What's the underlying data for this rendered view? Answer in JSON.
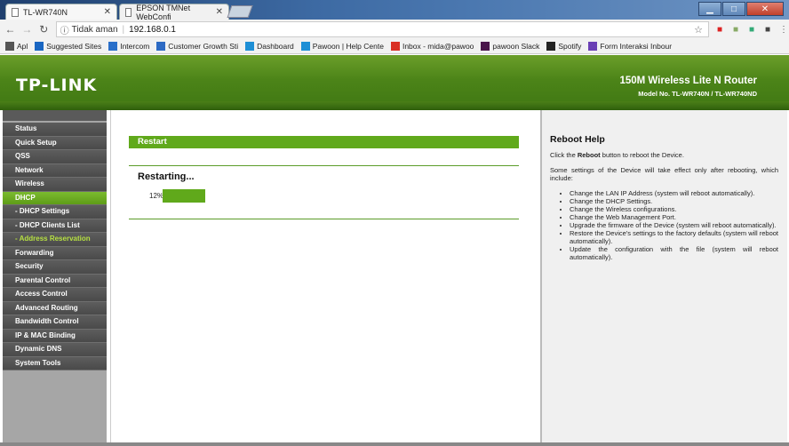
{
  "browser": {
    "tabs": [
      {
        "label": "TL-WR740N"
      },
      {
        "label": "EPSON TMNet WebConfi"
      }
    ],
    "address": {
      "security": "Tidak aman",
      "url": "192.168.0.1"
    },
    "bookmarks": [
      {
        "label": "Apl",
        "icon": "apps-grid-icon",
        "color": "#555555"
      },
      {
        "label": "Suggested Sites",
        "icon": "suggested-sites-icon",
        "color": "#1a66c2"
      },
      {
        "label": "Intercom",
        "icon": "intercom-icon",
        "color": "#2a6fc9"
      },
      {
        "label": "Customer Growth Sti",
        "icon": "sheet-icon",
        "color": "#2d6ac4"
      },
      {
        "label": "Dashboard",
        "icon": "p-icon",
        "color": "#1e8fd6"
      },
      {
        "label": "Pawoon | Help Cente",
        "icon": "p-icon",
        "color": "#1e8fd6"
      },
      {
        "label": "Inbox - mida@pawoo",
        "icon": "gmail-icon",
        "color": "#d93025"
      },
      {
        "label": "pawoon Slack",
        "icon": "slack-icon",
        "color": "#4a154b"
      },
      {
        "label": "Spotify",
        "icon": "spotify-icon",
        "color": "#222222"
      },
      {
        "label": "Form Interaksi Inbour",
        "icon": "form-icon",
        "color": "#6a3fb5"
      }
    ]
  },
  "router": {
    "brand": "TP-LINK",
    "product_name": "150M Wireless Lite N Router",
    "model": "Model No. TL-WR740N / TL-WR740ND"
  },
  "menu": [
    {
      "label": "Status",
      "key": "status"
    },
    {
      "label": "Quick Setup",
      "key": "quick-setup"
    },
    {
      "label": "QSS",
      "key": "qss"
    },
    {
      "label": "Network",
      "key": "network"
    },
    {
      "label": "Wireless",
      "key": "wireless"
    },
    {
      "label": "DHCP",
      "key": "dhcp"
    },
    {
      "label": "- DHCP Settings",
      "key": "dhcp-settings"
    },
    {
      "label": "- DHCP Clients List",
      "key": "dhcp-clients-list"
    },
    {
      "label": "- Address Reservation",
      "key": "address-reservation"
    },
    {
      "label": "Forwarding",
      "key": "forwarding"
    },
    {
      "label": "Security",
      "key": "security"
    },
    {
      "label": "Parental Control",
      "key": "parental-control"
    },
    {
      "label": "Access Control",
      "key": "access-control"
    },
    {
      "label": "Advanced Routing",
      "key": "advanced-routing"
    },
    {
      "label": "Bandwidth Control",
      "key": "bandwidth-control"
    },
    {
      "label": "IP & MAC Binding",
      "key": "ip-mac-binding"
    },
    {
      "label": "Dynamic DNS",
      "key": "dynamic-dns"
    },
    {
      "label": "System Tools",
      "key": "system-tools"
    }
  ],
  "main": {
    "title": "Restart",
    "status": "Restarting...",
    "progress_label": "12%",
    "progress": 0.12,
    "accent": "#60a91b"
  },
  "help": {
    "title": "Reboot Help",
    "intro_pre": "Click the ",
    "intro_bold": "Reboot",
    "intro_post": " button to reboot the Device.",
    "note": "Some settings of the Device will take effect only after rebooting, which include:",
    "items": [
      "Change the LAN IP Address (system will reboot automatically).",
      "Change the DHCP Settings.",
      "Change the Wireless configurations.",
      "Change the Web Management Port.",
      "Upgrade the firmware of the Device (system will reboot automatically).",
      "Restore the Device's settings to the factory defaults (system will reboot automatically).",
      "Update the configuration with the file (system will reboot automatically)."
    ]
  }
}
